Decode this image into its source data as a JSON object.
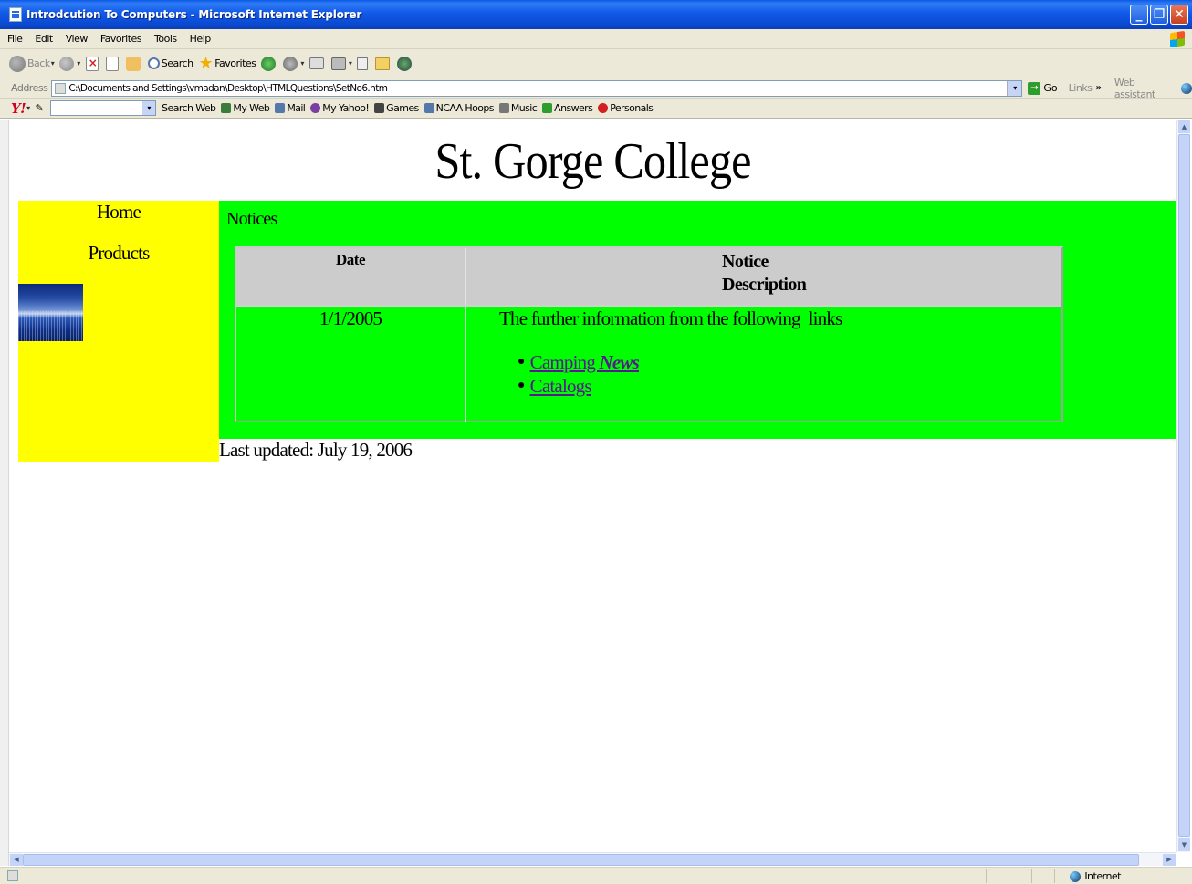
{
  "window": {
    "title": "Introdcution To Computers - Microsoft Internet Explorer",
    "controls": {
      "minimize": "_",
      "maximize": "❐",
      "close": "✕"
    }
  },
  "menu": [
    "File",
    "Edit",
    "View",
    "Favorites",
    "Tools",
    "Help"
  ],
  "toolbar": {
    "back_label": "Back",
    "search_label": "Search",
    "favorites_label": "Favorites"
  },
  "address": {
    "label": "Address",
    "url": "C:\\Documents and Settings\\vmadan\\Desktop\\HTMLQuestions\\SetNo6.htm",
    "go_label": "Go",
    "links_label": "Links",
    "links_chevron": "»",
    "web_assistant_label": "Web assistant"
  },
  "yahoo_toolbar": {
    "logo": "Y!",
    "search_web_label": "Search Web",
    "items": [
      "My Web",
      "Mail",
      "My Yahoo!",
      "Games",
      "NCAA Hoops",
      "Music",
      "Answers",
      "Personals"
    ],
    "icon_colors": [
      "#3a7d3a",
      "#5577aa",
      "#7a3fa0",
      "#444444",
      "#5577aa",
      "#777777",
      "#2e9c2e",
      "#d02020"
    ]
  },
  "page": {
    "title": "St. Gorge College",
    "nav": {
      "home": "Home",
      "products": "Products"
    },
    "section_label": "Notices",
    "table": {
      "headers": {
        "date": "Date",
        "notice_line1": "Notice",
        "notice_line2": "Description"
      },
      "rows": [
        {
          "date": "1/1/2005",
          "description": "The further information from the following  links",
          "links": [
            {
              "text": "Camping ",
              "emphasis": "News"
            },
            {
              "text": "Catalogs"
            }
          ]
        }
      ]
    },
    "last_updated": "Last updated: July 19, 2006"
  },
  "status": {
    "zone": "Internet"
  },
  "colors": {
    "nav_bg": "#ffff00",
    "main_bg": "#00ff00",
    "header_bg": "#cccccc",
    "link": "#551a8b"
  }
}
